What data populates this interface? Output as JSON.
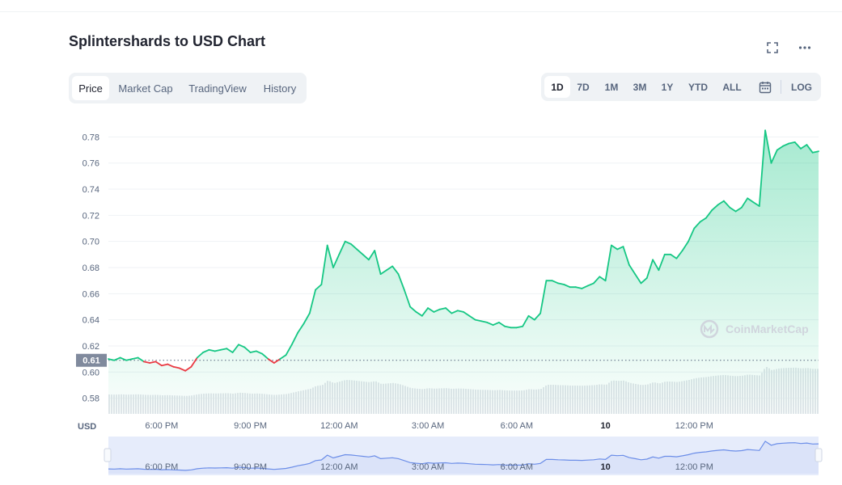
{
  "header": {
    "title": "Splintershards to USD Chart",
    "fullscreen_icon": "fullscreen-icon",
    "more_icon": "more-dots-icon"
  },
  "tabs_left": [
    "Price",
    "Market Cap",
    "TradingView",
    "History"
  ],
  "tabs_left_active": "Price",
  "tabs_right": [
    "1D",
    "7D",
    "1M",
    "3M",
    "1Y",
    "YTD",
    "ALL"
  ],
  "tabs_right_active": "1D",
  "calendar_icon": "calendar-icon",
  "log_label": "LOG",
  "watermark": "CoinMarketCap",
  "currency_label": "USD",
  "colors": {
    "up": "#16c784",
    "down": "#ea3943",
    "nav_line": "#6c8ee8",
    "grid": "#eff2f5"
  },
  "chart_data": {
    "type": "line",
    "title": "Splintershards to USD Chart",
    "ylabel": "USD",
    "y_ticks": [
      0.58,
      0.6,
      0.62,
      0.64,
      0.66,
      0.68,
      0.7,
      0.72,
      0.74,
      0.76,
      0.78
    ],
    "ylim": [
      0.568,
      0.792
    ],
    "x_ticks": [
      "6:00 PM",
      "9:00 PM",
      "12:00 AM",
      "3:00 AM",
      "6:00 AM",
      "10",
      "12:00 PM"
    ],
    "x_tick_hours": [
      18,
      21,
      24,
      27,
      30,
      33,
      36
    ],
    "x_range_hours": [
      16.2,
      40.2
    ],
    "reference_price": 0.609,
    "reference_label": "0.61",
    "series": [
      {
        "points": [
          [
            16.2,
            0.61
          ],
          [
            16.4,
            0.609
          ],
          [
            16.6,
            0.611
          ],
          [
            16.8,
            0.609
          ],
          [
            17.0,
            0.61
          ],
          [
            17.2,
            0.611
          ],
          [
            17.4,
            0.608
          ],
          [
            17.6,
            0.607
          ],
          [
            17.8,
            0.608
          ],
          [
            18.0,
            0.605
          ],
          [
            18.2,
            0.606
          ],
          [
            18.4,
            0.604
          ],
          [
            18.6,
            0.603
          ],
          [
            18.8,
            0.601
          ],
          [
            19.0,
            0.604
          ],
          [
            19.2,
            0.611
          ],
          [
            19.4,
            0.615
          ],
          [
            19.6,
            0.617
          ],
          [
            19.8,
            0.616
          ],
          [
            20.0,
            0.617
          ],
          [
            20.2,
            0.618
          ],
          [
            20.4,
            0.615
          ],
          [
            20.6,
            0.621
          ],
          [
            20.8,
            0.619
          ],
          [
            21.0,
            0.615
          ],
          [
            21.2,
            0.616
          ],
          [
            21.4,
            0.614
          ],
          [
            21.6,
            0.61
          ],
          [
            21.8,
            0.607
          ],
          [
            22.0,
            0.61
          ],
          [
            22.2,
            0.613
          ],
          [
            22.4,
            0.621
          ],
          [
            22.6,
            0.63
          ],
          [
            22.8,
            0.637
          ],
          [
            23.0,
            0.645
          ],
          [
            23.2,
            0.663
          ],
          [
            23.4,
            0.667
          ],
          [
            23.6,
            0.697
          ],
          [
            23.8,
            0.68
          ],
          [
            24.0,
            0.69
          ],
          [
            24.2,
            0.7
          ],
          [
            24.4,
            0.698
          ],
          [
            24.6,
            0.694
          ],
          [
            24.8,
            0.69
          ],
          [
            25.0,
            0.686
          ],
          [
            25.2,
            0.693
          ],
          [
            25.4,
            0.675
          ],
          [
            25.6,
            0.678
          ],
          [
            25.8,
            0.681
          ],
          [
            26.0,
            0.675
          ],
          [
            26.2,
            0.663
          ],
          [
            26.4,
            0.65
          ],
          [
            26.6,
            0.646
          ],
          [
            26.8,
            0.643
          ],
          [
            27.0,
            0.649
          ],
          [
            27.2,
            0.646
          ],
          [
            27.4,
            0.648
          ],
          [
            27.6,
            0.649
          ],
          [
            27.8,
            0.645
          ],
          [
            28.0,
            0.647
          ],
          [
            28.2,
            0.646
          ],
          [
            28.4,
            0.643
          ],
          [
            28.6,
            0.64
          ],
          [
            28.8,
            0.639
          ],
          [
            29.0,
            0.638
          ],
          [
            29.2,
            0.636
          ],
          [
            29.4,
            0.638
          ],
          [
            29.6,
            0.635
          ],
          [
            29.8,
            0.634
          ],
          [
            30.0,
            0.634
          ],
          [
            30.2,
            0.635
          ],
          [
            30.4,
            0.643
          ],
          [
            30.6,
            0.64
          ],
          [
            30.8,
            0.645
          ],
          [
            31.0,
            0.67
          ],
          [
            31.2,
            0.67
          ],
          [
            31.4,
            0.668
          ],
          [
            31.6,
            0.667
          ],
          [
            31.8,
            0.665
          ],
          [
            32.0,
            0.665
          ],
          [
            32.2,
            0.664
          ],
          [
            32.4,
            0.666
          ],
          [
            32.6,
            0.668
          ],
          [
            32.8,
            0.673
          ],
          [
            33.0,
            0.67
          ],
          [
            33.2,
            0.697
          ],
          [
            33.4,
            0.694
          ],
          [
            33.6,
            0.696
          ],
          [
            33.8,
            0.682
          ],
          [
            34.0,
            0.675
          ],
          [
            34.2,
            0.668
          ],
          [
            34.4,
            0.672
          ],
          [
            34.6,
            0.686
          ],
          [
            34.8,
            0.678
          ],
          [
            35.0,
            0.69
          ],
          [
            35.2,
            0.69
          ],
          [
            35.4,
            0.687
          ],
          [
            35.6,
            0.693
          ],
          [
            35.8,
            0.7
          ],
          [
            36.0,
            0.71
          ],
          [
            36.2,
            0.715
          ],
          [
            36.4,
            0.718
          ],
          [
            36.6,
            0.724
          ],
          [
            36.8,
            0.728
          ],
          [
            37.0,
            0.731
          ],
          [
            37.2,
            0.726
          ],
          [
            37.4,
            0.723
          ],
          [
            37.6,
            0.726
          ],
          [
            37.8,
            0.733
          ],
          [
            38.0,
            0.73
          ],
          [
            38.2,
            0.727
          ],
          [
            38.4,
            0.785
          ],
          [
            38.6,
            0.76
          ],
          [
            38.8,
            0.77
          ],
          [
            39.0,
            0.773
          ],
          [
            39.2,
            0.775
          ],
          [
            39.4,
            0.776
          ],
          [
            39.6,
            0.771
          ],
          [
            39.8,
            0.774
          ],
          [
            40.0,
            0.768
          ],
          [
            40.2,
            0.769
          ]
        ]
      }
    ],
    "volume_bars": 3,
    "navigator_x_ticks": [
      "6:00 PM",
      "9:00 PM",
      "12:00 AM",
      "3:00 AM",
      "6:00 AM",
      "10",
      "12:00 PM"
    ]
  }
}
